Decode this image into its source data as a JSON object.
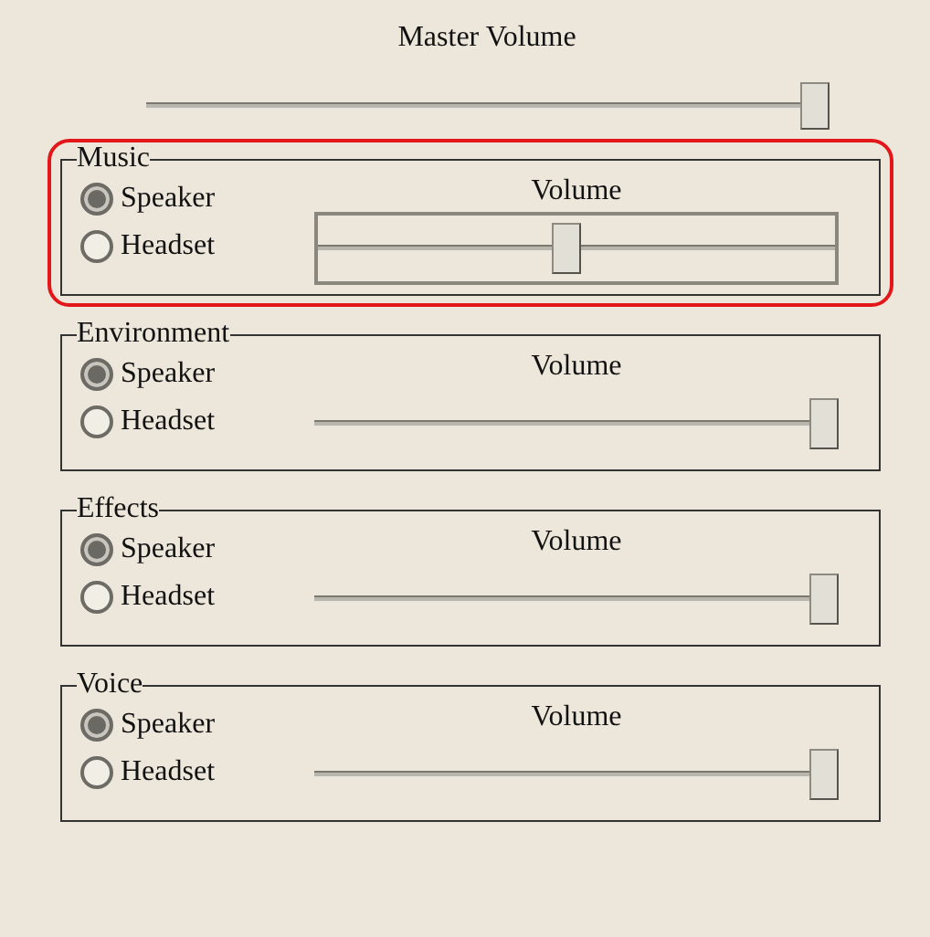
{
  "master": {
    "title": "Master Volume",
    "level": 1.0
  },
  "groups": [
    {
      "title": "Music",
      "highlighted": true,
      "options": [
        {
          "label": "Speaker",
          "selected": true
        },
        {
          "label": "Headset",
          "selected": false
        }
      ],
      "volume_label": "Volume",
      "level": 0.48,
      "focused": true
    },
    {
      "title": "Environment",
      "highlighted": false,
      "options": [
        {
          "label": "Speaker",
          "selected": true
        },
        {
          "label": "Headset",
          "selected": false
        }
      ],
      "volume_label": "Volume",
      "level": 1.0,
      "focused": false
    },
    {
      "title": "Effects",
      "highlighted": false,
      "options": [
        {
          "label": "Speaker",
          "selected": true
        },
        {
          "label": "Headset",
          "selected": false
        }
      ],
      "volume_label": "Volume",
      "level": 1.0,
      "focused": false
    },
    {
      "title": "Voice",
      "highlighted": false,
      "options": [
        {
          "label": "Speaker",
          "selected": true
        },
        {
          "label": "Headset",
          "selected": false
        }
      ],
      "volume_label": "Volume",
      "level": 1.0,
      "focused": false
    }
  ]
}
